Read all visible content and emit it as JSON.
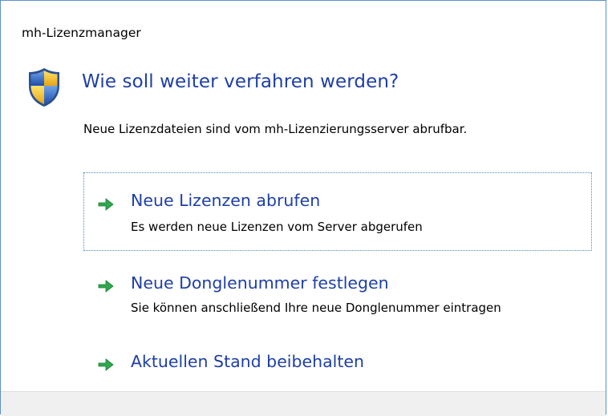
{
  "window": {
    "title": "mh-Lizenzmanager"
  },
  "dialog": {
    "heading": "Wie soll weiter verfahren werden?",
    "description": "Neue Lizenzdateien sind vom mh-Lizenzierungsserver abrufbar.",
    "icon": "uac-shield-icon",
    "options": [
      {
        "title": "Neue Lizenzen abrufen",
        "subtitle": "Es werden neue Lizenzen vom Server abgerufen",
        "icon": "green-arrow-icon",
        "focused": true
      },
      {
        "title": "Neue Donglenummer festlegen",
        "subtitle": "Sie können anschließend Ihre neue Donglenummer eintragen",
        "icon": "green-arrow-icon",
        "focused": false
      },
      {
        "title": "Aktuellen Stand beibehalten",
        "icon": "green-arrow-icon",
        "focused": false
      }
    ]
  },
  "colors": {
    "heading": "#1e3fa6",
    "border": "#5b8fc9",
    "arrow": "#2fa84f",
    "footer": "#f0f0f0"
  }
}
